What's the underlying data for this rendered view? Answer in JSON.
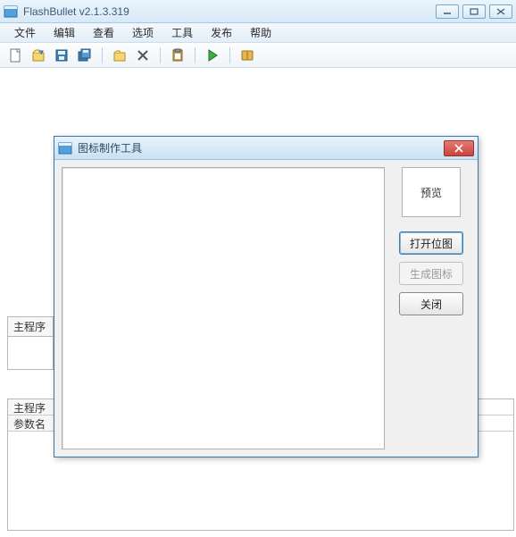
{
  "window": {
    "title": "FlashBullet v2.1.3.319"
  },
  "menu": {
    "file": "文件",
    "edit": "编辑",
    "view": "查看",
    "options": "选项",
    "tools": "工具",
    "publish": "发布",
    "help": "帮助"
  },
  "toolbar_icons": {
    "new": "new-document",
    "open": "open-arrow",
    "save": "save-disk",
    "saveall": "save-all-disks",
    "folder": "folder",
    "delete": "delete-x",
    "paste": "clipboard",
    "run": "run-play",
    "book": "book"
  },
  "panels": {
    "main_program": "主程序",
    "main_program_entry": "主程序启",
    "param_name": "参数名"
  },
  "dialog": {
    "title": "图标制作工具",
    "preview_label": "预览",
    "open_bitmap": "打开位图",
    "generate_icon": "生成图标",
    "close": "关闭"
  }
}
